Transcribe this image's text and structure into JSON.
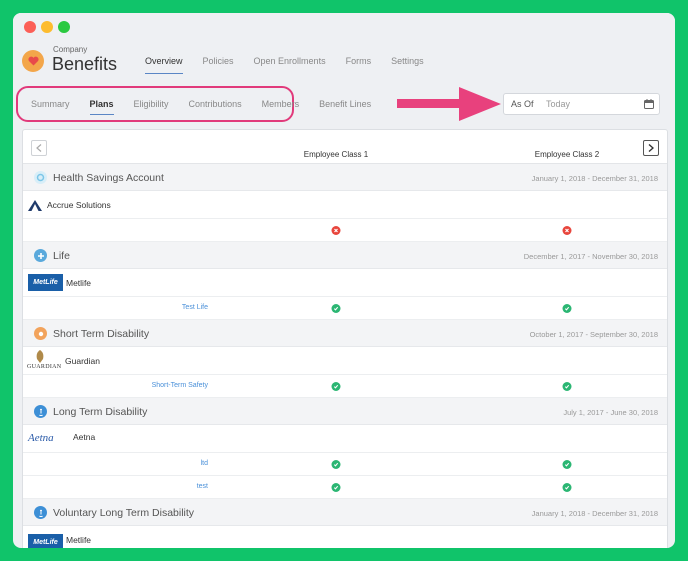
{
  "header": {
    "company_label": "Company",
    "app_title": "Benefits",
    "nav": [
      {
        "label": "Overview",
        "active": true
      },
      {
        "label": "Policies",
        "active": false
      },
      {
        "label": "Open Enrollments",
        "active": false
      },
      {
        "label": "Forms",
        "active": false
      },
      {
        "label": "Settings",
        "active": false
      }
    ]
  },
  "subnav": {
    "tabs": [
      {
        "label": "Summary",
        "active": false
      },
      {
        "label": "Plans",
        "active": true
      },
      {
        "label": "Eligibility",
        "active": false
      },
      {
        "label": "Contributions",
        "active": false
      },
      {
        "label": "Members",
        "active": false
      },
      {
        "label": "Benefit Lines",
        "active": false
      }
    ]
  },
  "date_filter": {
    "label": "As Of",
    "value": "Today",
    "icon": "calendar-icon"
  },
  "table": {
    "columns": [
      "Employee Class 1",
      "Employee Class 2"
    ],
    "sections": [
      {
        "title": "Health Savings Account",
        "dates": "January 1, 2018 - December 31, 2018",
        "icon": "hsa-icon",
        "icon_color": "#7cc6e8",
        "carrier": "Accrue Solutions",
        "carrier_logo": "accrue-logo",
        "plans": [
          {
            "name": "",
            "status": [
              "x",
              "x"
            ]
          }
        ]
      },
      {
        "title": "Life",
        "dates": "December 1, 2017 - November 30, 2018",
        "icon": "life-icon",
        "icon_color": "#5aa9dc",
        "carrier": "Metlife",
        "carrier_logo": "metlife-logo",
        "carrier_logo_text": "MetLife",
        "plans": [
          {
            "name": "Test Life",
            "status": [
              "check",
              "check"
            ]
          }
        ]
      },
      {
        "title": "Short Term Disability",
        "dates": "October 1, 2017 - September 30, 2018",
        "icon": "std-icon",
        "icon_color": "#f2a35c",
        "carrier": "Guardian",
        "carrier_logo": "guardian-logo",
        "carrier_logo_text": "GUARDIAN",
        "plans": [
          {
            "name": "Short-Term Safety",
            "status": [
              "check",
              "check"
            ]
          }
        ]
      },
      {
        "title": "Long Term Disability",
        "dates": "July 1, 2017 - June 30, 2018",
        "icon": "ltd-icon",
        "icon_color": "#3d8fd6",
        "carrier": "Aetna",
        "carrier_logo": "aetna-logo",
        "carrier_logo_text": "Aetna",
        "plans": [
          {
            "name": "ltd",
            "status": [
              "check",
              "check"
            ]
          },
          {
            "name": "test",
            "status": [
              "check",
              "check"
            ]
          }
        ]
      },
      {
        "title": "Voluntary Long Term Disability",
        "dates": "January 1, 2018 - December 31, 2018",
        "icon": "vltd-icon",
        "icon_color": "#3d8fd6",
        "carrier": "Metlife",
        "carrier_logo": "metlife-logo",
        "carrier_logo_text": "MetLife",
        "plans": []
      }
    ]
  },
  "colors": {
    "background": "#10c46a",
    "highlight_oval": "#e13a7b",
    "arrow": "#e8417d",
    "link": "#4a90d9",
    "ok": "#2bb673",
    "error": "#e8463d"
  }
}
